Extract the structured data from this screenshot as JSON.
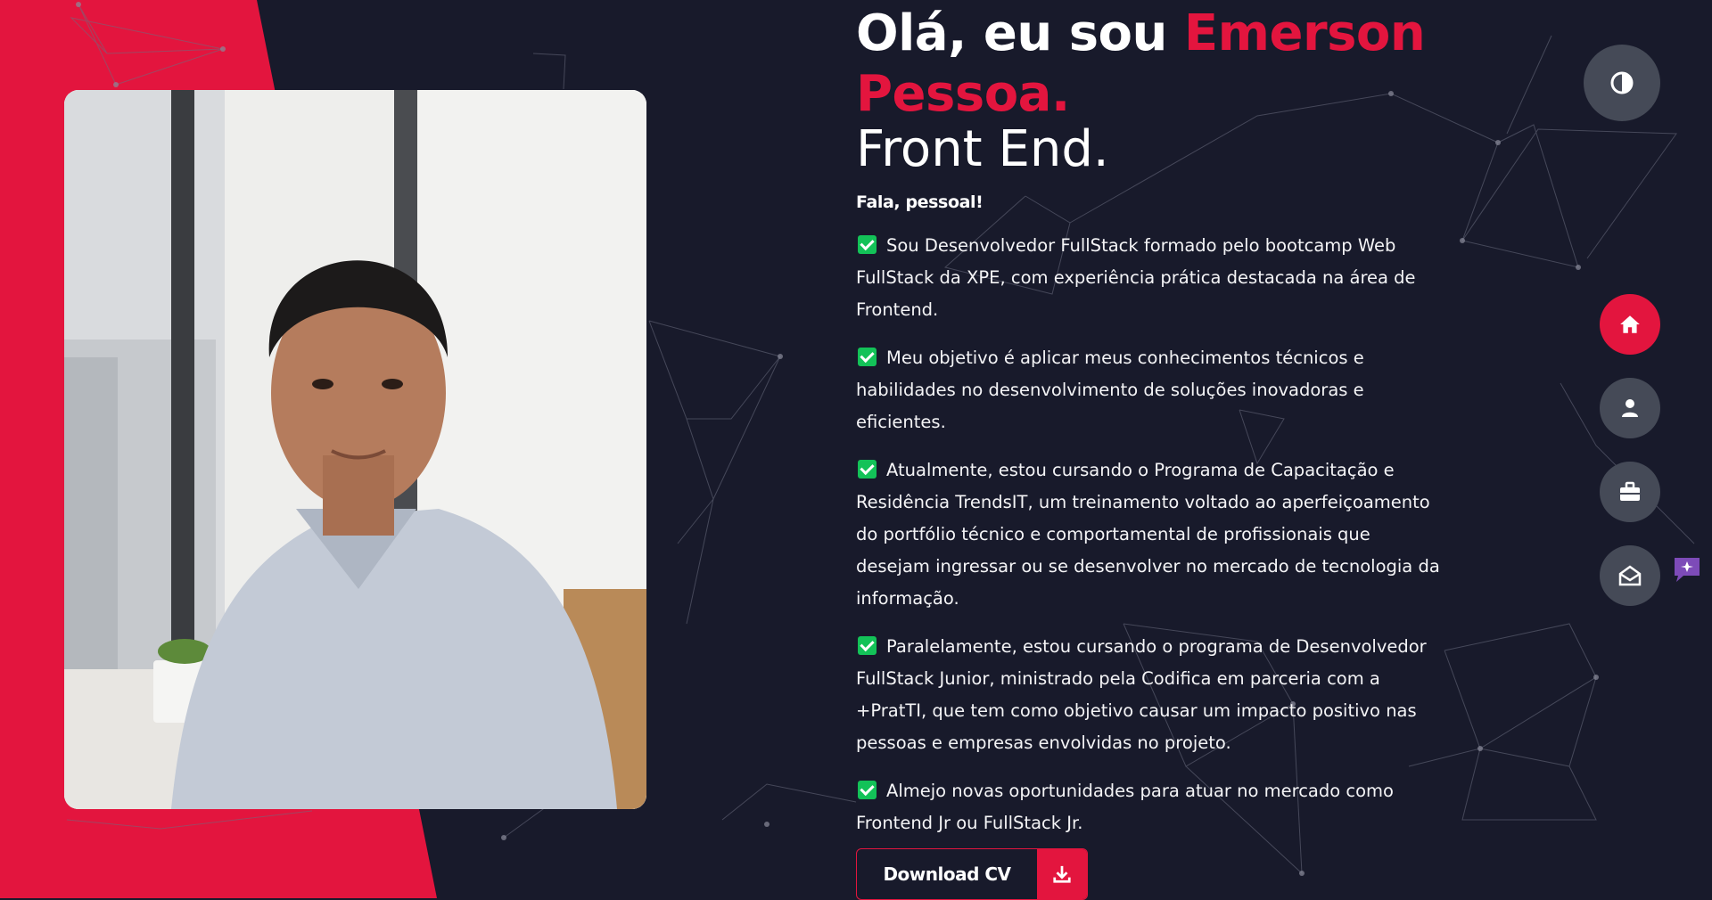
{
  "colors": {
    "accent": "#e3153e",
    "background": "#181a2b",
    "nav_bg": "#454a57",
    "check": "#13c258",
    "chat": "#7d4bb8"
  },
  "hero": {
    "greeting_prefix": "Olá, eu sou",
    "name_first": "Emerson",
    "name_last": "Pessoa.",
    "role": "Front End.",
    "intro": "Fala, pessoal!",
    "bio": [
      "Sou Desenvolvedor FullStack formado pelo bootcamp Web FullStack da XPE, com experiência prática destacada na área de Frontend.",
      "Meu objetivo é aplicar meus conhecimentos técnicos e habilidades no desenvolvimento de soluções inovadoras e eficientes.",
      "Atualmente, estou cursando o Programa de Capacitação e Residência TrendsIT, um treinamento voltado ao aperfeiçoamento do portfólio técnico e comportamental de profissionais que desejam ingressar ou se desenvolver no mercado de tecnologia da informação.",
      "Paralelamente, estou cursando o programa de Desenvolvedor FullStack Junior, ministrado pela Codifica em parceria com a +PratTI, que tem como objetivo causar um impacto positivo nas pessoas e empresas envolvidas no projeto.",
      "Almejo novas oportunidades para atuar no mercado como Frontend Jr ou FullStack Jr."
    ],
    "download_label": "Download CV",
    "download_icon": "download-icon"
  },
  "nav": {
    "theme_icon": "contrast-icon",
    "items": [
      {
        "icon": "home-icon",
        "active": true
      },
      {
        "icon": "user-icon",
        "active": false
      },
      {
        "icon": "briefcase-icon",
        "active": false
      },
      {
        "icon": "envelope-open-icon",
        "active": false
      }
    ],
    "chat_icon": "chat-sparkle-icon"
  }
}
